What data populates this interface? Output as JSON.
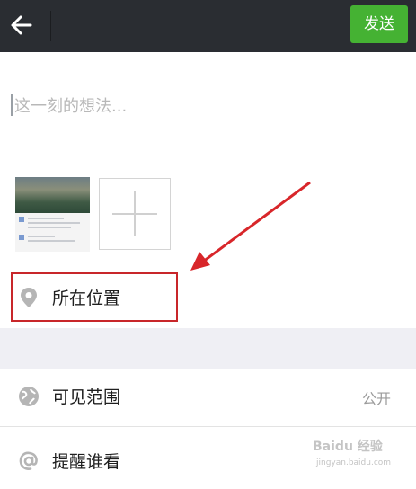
{
  "header": {
    "send_label": "发送",
    "back_icon": "arrow-left-icon"
  },
  "compose": {
    "placeholder": "这一刻的想法..."
  },
  "attachments": {
    "add_icon": "plus-icon"
  },
  "rows": {
    "location": {
      "label": "所在位置",
      "icon": "location-pin-icon"
    },
    "visibility": {
      "label": "可见范围",
      "value": "公开",
      "icon": "globe-icon"
    },
    "mention": {
      "label": "提醒谁看",
      "icon": "at-icon"
    }
  },
  "watermark": {
    "text": "Baidu 经验",
    "sub": "jingyan.baidu.com"
  },
  "colors": {
    "topbar": "#2a2d32",
    "send_button": "#45b233",
    "highlight": "#c8262a",
    "section_gap": "#efeff4"
  }
}
